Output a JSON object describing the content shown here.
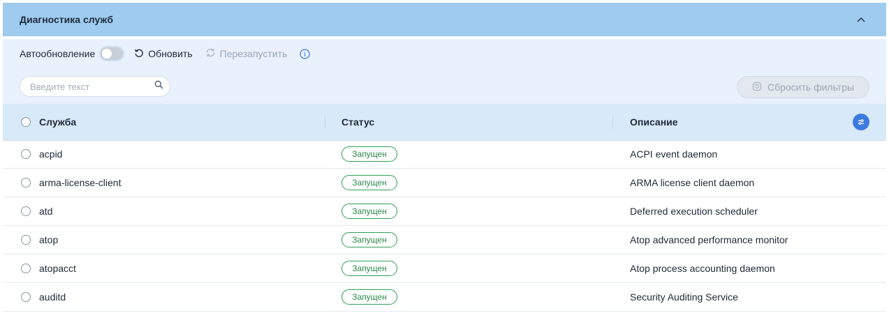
{
  "panel": {
    "title": "Диагностика служб"
  },
  "toolbar": {
    "autorefresh_label": "Автообновление",
    "autorefresh_on": false,
    "refresh_label": "Обновить",
    "restart_label": "Перезапустить"
  },
  "search": {
    "placeholder": "Введите текст",
    "value": ""
  },
  "reset_filters_label": "Сбросить фильтры",
  "table": {
    "columns": {
      "name": "Служба",
      "status": "Статус",
      "description": "Описание"
    },
    "rows": [
      {
        "name": "acpid",
        "status": "Запущен",
        "description": "ACPI event daemon"
      },
      {
        "name": "arma-license-client",
        "status": "Запущен",
        "description": "ARMA license client daemon"
      },
      {
        "name": "atd",
        "status": "Запущен",
        "description": "Deferred execution scheduler"
      },
      {
        "name": "atop",
        "status": "Запущен",
        "description": "Atop advanced performance monitor"
      },
      {
        "name": "atopacct",
        "status": "Запущен",
        "description": "Atop process accounting daemon"
      },
      {
        "name": "auditd",
        "status": "Запущен",
        "description": "Security Auditing Service"
      }
    ]
  },
  "icons": {
    "collapse": "chevron-up-icon",
    "refresh": "refresh-icon",
    "restart": "restart-icon",
    "info": "info-icon",
    "search": "search-icon",
    "reset": "reset-filter-icon",
    "settings": "column-settings-icon"
  },
  "colors": {
    "header_bg": "#9ecbee",
    "toolbar_bg": "#e8f1fc",
    "table_head_bg": "#d8e9f9",
    "status_green": "#2e9e55",
    "accent_blue": "#3b7be0"
  }
}
